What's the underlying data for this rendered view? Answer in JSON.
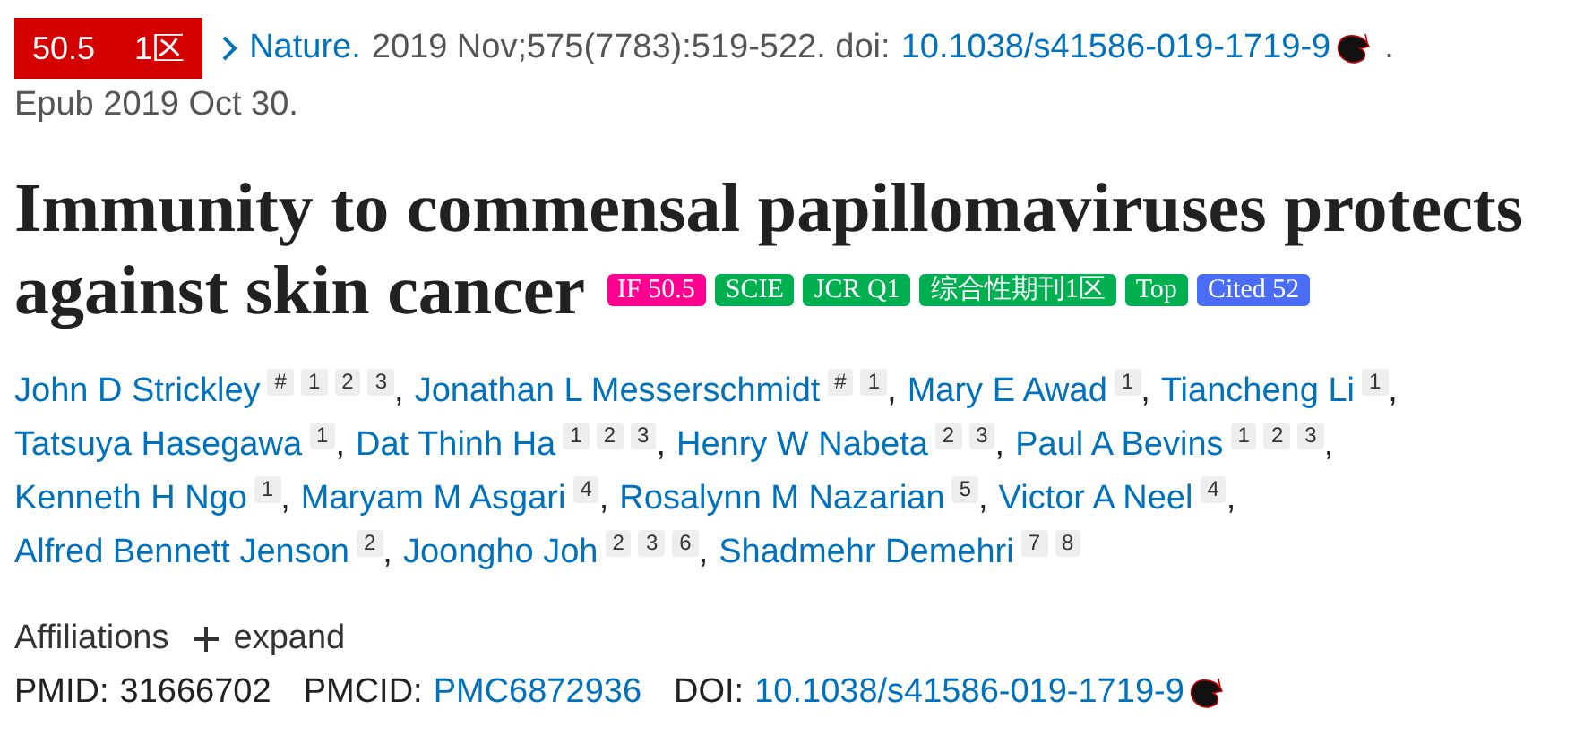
{
  "journal_badge": {
    "impact": "50.5",
    "zone": "1区"
  },
  "citation": {
    "journal": "Nature.",
    "details": "2019 Nov;575(7783):519-522. doi:",
    "doi": "10.1038/s41586-019-1719-9",
    "end": ".",
    "epub": "Epub 2019 Oct 30."
  },
  "title_lines": [
    "Immunity to commensal papillomaviruses protects",
    "against skin cancer"
  ],
  "tags": [
    {
      "label": "IF 50.5",
      "color": "#ff0090"
    },
    {
      "label": "SCIE",
      "color": "#00b050"
    },
    {
      "label": "JCR Q1",
      "color": "#00b050"
    },
    {
      "label": "综合性期刊1区",
      "color": "#00b050"
    },
    {
      "label": "Top",
      "color": "#00b050"
    },
    {
      "label": "Cited 52",
      "color": "#4a6cf7"
    }
  ],
  "author_rows": [
    [
      {
        "name": "John D Strickley",
        "marks": [
          "#",
          "1",
          "2",
          "3"
        ],
        "sep": ","
      },
      {
        "name": "Jonathan L Messerschmidt",
        "marks": [
          "#",
          "1"
        ],
        "sep": ","
      },
      {
        "name": "Mary E Awad",
        "marks": [
          "1"
        ],
        "sep": ","
      },
      {
        "name": "Tiancheng Li",
        "marks": [
          "1"
        ],
        "sep": ","
      }
    ],
    [
      {
        "name": "Tatsuya Hasegawa",
        "marks": [
          "1"
        ],
        "sep": ","
      },
      {
        "name": "Dat Thinh Ha",
        "marks": [
          "1",
          "2",
          "3"
        ],
        "sep": ","
      },
      {
        "name": "Henry W Nabeta",
        "marks": [
          "2",
          "3"
        ],
        "sep": ","
      },
      {
        "name": "Paul A Bevins",
        "marks": [
          "1",
          "2",
          "3"
        ],
        "sep": ","
      }
    ],
    [
      {
        "name": "Kenneth H Ngo",
        "marks": [
          "1"
        ],
        "sep": ","
      },
      {
        "name": "Maryam M Asgari",
        "marks": [
          "4"
        ],
        "sep": ","
      },
      {
        "name": "Rosalynn M Nazarian",
        "marks": [
          "5"
        ],
        "sep": ","
      },
      {
        "name": "Victor A Neel",
        "marks": [
          "4"
        ],
        "sep": ","
      }
    ],
    [
      {
        "name": "Alfred Bennett Jenson",
        "marks": [
          "2"
        ],
        "sep": ","
      },
      {
        "name": "Joongho Joh",
        "marks": [
          "2",
          "3",
          "6"
        ],
        "sep": ","
      },
      {
        "name": "Shadmehr Demehri",
        "marks": [
          "7",
          "8"
        ]
      }
    ]
  ],
  "affiliations": {
    "label": "Affiliations",
    "toggle": "expand"
  },
  "identifiers": [
    {
      "kind": "text",
      "label": "PMID:",
      "value": "31666702"
    },
    {
      "kind": "link",
      "label": "PMCID:",
      "value": "PMC6872936"
    },
    {
      "kind": "link_icon",
      "label": "DOI:",
      "value": "10.1038/s41586-019-1719-9"
    }
  ]
}
